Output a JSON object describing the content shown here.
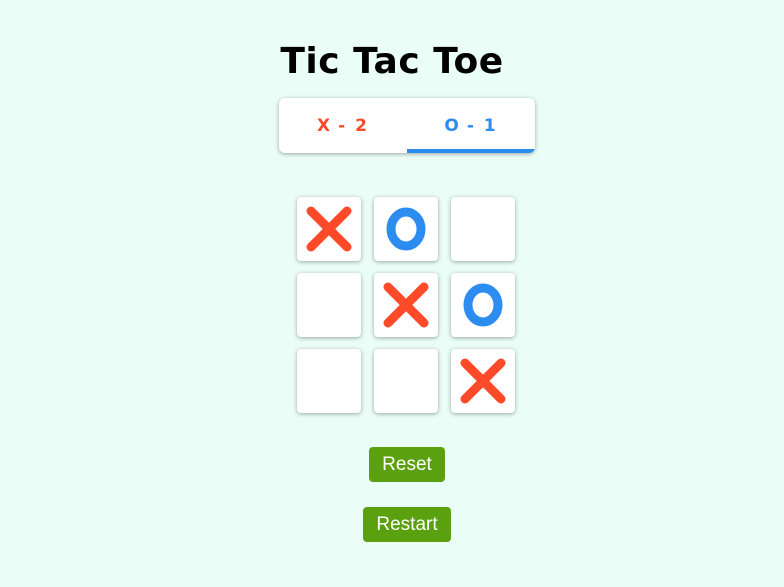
{
  "title": "Tic Tac Toe",
  "scoreboard": {
    "x": {
      "symbol": "X",
      "score_text": "- 2",
      "color": "#ff4a2a"
    },
    "o": {
      "symbol": "O",
      "score_text": "- 1",
      "color": "#2d8cf0",
      "active": true
    }
  },
  "board": {
    "cells": [
      "X",
      "O",
      "",
      "",
      "X",
      "O",
      "",
      "",
      "X"
    ]
  },
  "buttons": {
    "reset_label": "Reset",
    "restart_label": "Restart"
  },
  "colors": {
    "background": "#eafdf7",
    "x": "#ff4a2a",
    "o": "#2d8cf0",
    "button": "#5aa00f"
  }
}
